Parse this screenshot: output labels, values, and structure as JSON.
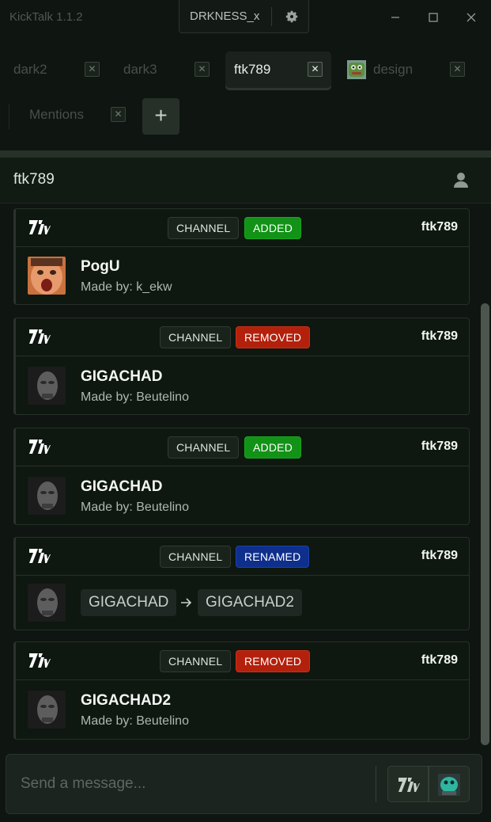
{
  "app": {
    "title": "KickTalk 1.1.2"
  },
  "user": {
    "name": "DRKNESS_x"
  },
  "tabs": [
    {
      "label": "dark2",
      "active": false
    },
    {
      "label": "dark3",
      "active": false
    },
    {
      "label": "ftk789",
      "active": true
    },
    {
      "label": "design",
      "active": false
    },
    {
      "label": "Mentions",
      "active": false
    }
  ],
  "tab_close_glyph": "✕",
  "add_tab_glyph": "+",
  "channel": {
    "name": "ftk789"
  },
  "messages": [
    {
      "scope": "CHANNEL",
      "action": "ADDED",
      "user": "ftk789",
      "emote": "PogU",
      "by": "Made by: k_ekw"
    },
    {
      "scope": "CHANNEL",
      "action": "REMOVED",
      "user": "ftk789",
      "emote": "GIGACHAD",
      "by": "Made by: Beutelino"
    },
    {
      "scope": "CHANNEL",
      "action": "ADDED",
      "user": "ftk789",
      "emote": "GIGACHAD",
      "by": "Made by: Beutelino"
    },
    {
      "scope": "CHANNEL",
      "action": "RENAMED",
      "user": "ftk789",
      "old_name": "GIGACHAD",
      "new_name": "GIGACHAD2"
    },
    {
      "scope": "CHANNEL",
      "action": "REMOVED",
      "user": "ftk789",
      "emote": "GIGACHAD2",
      "by": "Made by: Beutelino"
    }
  ],
  "composer": {
    "placeholder": "Send a message..."
  },
  "colors": {
    "added": "#129217",
    "removed": "#b3200b",
    "renamed": "#0f2f8c",
    "background": "#0f1510"
  },
  "icons": [
    "gear-icon",
    "minimize-icon",
    "maximize-icon",
    "close-icon",
    "user-icon",
    "7tv-logo-icon",
    "pepe-icon",
    "arrow-right-icon",
    "emoji-icon"
  ]
}
